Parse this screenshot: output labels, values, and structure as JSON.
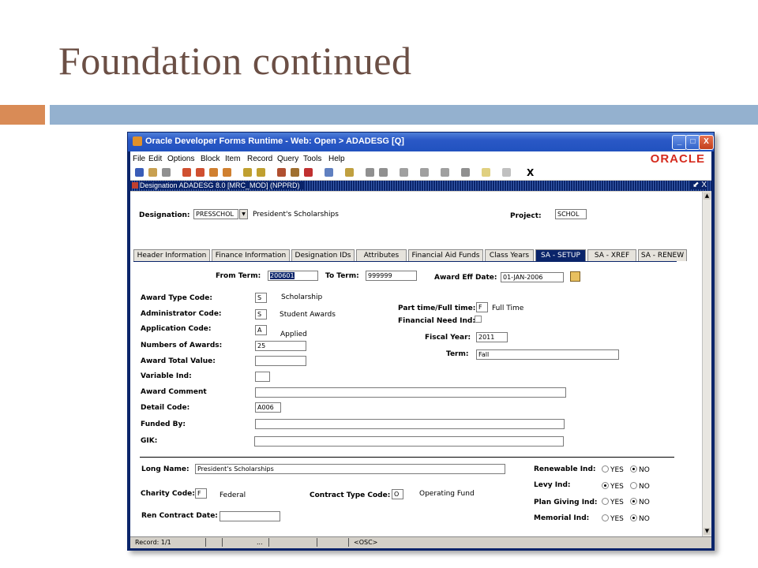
{
  "slide": {
    "title": "Foundation continued"
  },
  "window": {
    "title": "Oracle Developer Forms Runtime - Web:  Open > ADADESG [Q]",
    "brand": "ORACLE",
    "minimize": "_",
    "maximize": "□",
    "close": "X"
  },
  "menu": [
    "File",
    "Edit",
    "Options",
    "Block",
    "Item",
    "Record",
    "Query",
    "Tools",
    "Help"
  ],
  "toolbar": {
    "exit_label": "X"
  },
  "inner_window": {
    "title": "Designation  ADADESG  8.0  [MRC_MOD]  (NPPRD)",
    "controls": "⬋ X"
  },
  "header": {
    "designation_label": "Designation:",
    "designation_value": "PRESSCHOL",
    "designation_desc": "President's Scholarships",
    "project_label": "Project:",
    "project_value": "SCHOL"
  },
  "tabs": [
    {
      "label": "Header Information",
      "active": false
    },
    {
      "label": "Finance Information",
      "active": false
    },
    {
      "label": "Designation IDs",
      "active": false
    },
    {
      "label": "Attributes",
      "active": false
    },
    {
      "label": "Financial Aid Funds",
      "active": false
    },
    {
      "label": "Class Years",
      "active": false
    },
    {
      "label": "SA - SETUP",
      "active": true
    },
    {
      "label": "SA - XREF",
      "active": false
    },
    {
      "label": "SA - RENEW",
      "active": false
    }
  ],
  "form": {
    "from_term_label": "From Term:",
    "from_term": "200601",
    "to_term_label": "To Term:",
    "to_term": "999999",
    "award_eff_date_label": "Award Eff Date:",
    "award_eff_date": "01-JAN-2006",
    "award_type_label": "Award Type Code:",
    "award_type": "S",
    "award_type_desc": "Scholarship",
    "admin_code_label": "Administrator Code:",
    "admin_code": "S",
    "admin_code_desc": "Student Awards",
    "app_code_label": "Application Code:",
    "app_code": "A",
    "app_code_desc": "Applied",
    "num_awards_label": "Numbers of Awards:",
    "num_awards": "25",
    "award_total_label": "Award Total Value:",
    "award_total": "",
    "variable_ind_label": "Variable Ind:",
    "variable_ind": "",
    "award_comment_label": "Award Comment",
    "award_comment": "",
    "detail_code_label": "Detail Code:",
    "detail_code": "A006",
    "funded_by_label": "Funded By:",
    "funded_by": "",
    "gik_label": "GIK:",
    "gik": "",
    "part_full_label": "Part time/Full time:",
    "part_full": "F",
    "part_full_desc": "Full Time",
    "fin_need_label": "Financial Need Ind:",
    "fiscal_year_label": "Fiscal Year:",
    "fiscal_year": "2011",
    "term_label": "Term:",
    "term": "Fall",
    "long_name_label": "Long Name:",
    "long_name": "President's Scholarships",
    "charity_label": "Charity Code:",
    "charity": "F",
    "charity_desc": "Federal",
    "contract_type_label": "Contract Type Code:",
    "contract_type": "O",
    "contract_type_desc": "Operating Fund",
    "ren_contract_label": "Ren Contract Date:",
    "ren_contract": "",
    "renewable_label": "Renewable Ind:",
    "levy_label": "Levy Ind:",
    "plan_giving_label": "Plan Giving Ind:",
    "memorial_label": "Memorial Ind:",
    "yes": "YES",
    "no": "NO",
    "renewable_value": "NO",
    "levy_value": "YES",
    "plan_giving_value": "NO",
    "memorial_value": "NO"
  },
  "status": {
    "record": "Record: 1/1",
    "ellipsis": "...",
    "mode": "<OSC>"
  }
}
